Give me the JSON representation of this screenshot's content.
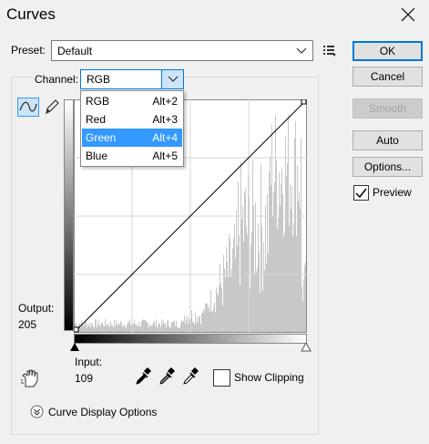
{
  "dialog": {
    "title": "Curves"
  },
  "preset": {
    "label": "Preset:",
    "value": "Default"
  },
  "channel": {
    "label": "Channel:",
    "value": "RGB",
    "options": [
      {
        "name": "RGB",
        "shortcut": "Alt+2"
      },
      {
        "name": "Red",
        "shortcut": "Alt+3"
      },
      {
        "name": "Green",
        "shortcut": "Alt+4"
      },
      {
        "name": "Blue",
        "shortcut": "Alt+5"
      }
    ],
    "highlighted": "Green"
  },
  "buttons": {
    "ok": "OK",
    "cancel": "Cancel",
    "smooth": "Smooth",
    "auto": "Auto",
    "options": "Options..."
  },
  "preview": {
    "label": "Preview",
    "checked": true
  },
  "output": {
    "label": "Output:",
    "value": "205"
  },
  "input": {
    "label": "Input:",
    "value": "109"
  },
  "show_clipping": {
    "label": "Show Clipping",
    "checked": false
  },
  "curve_display_options": {
    "label": "Curve Display Options"
  },
  "colors": {
    "accent": "#0078d7",
    "highlight": "#3399ff",
    "histogram": "#c8c8c8"
  }
}
